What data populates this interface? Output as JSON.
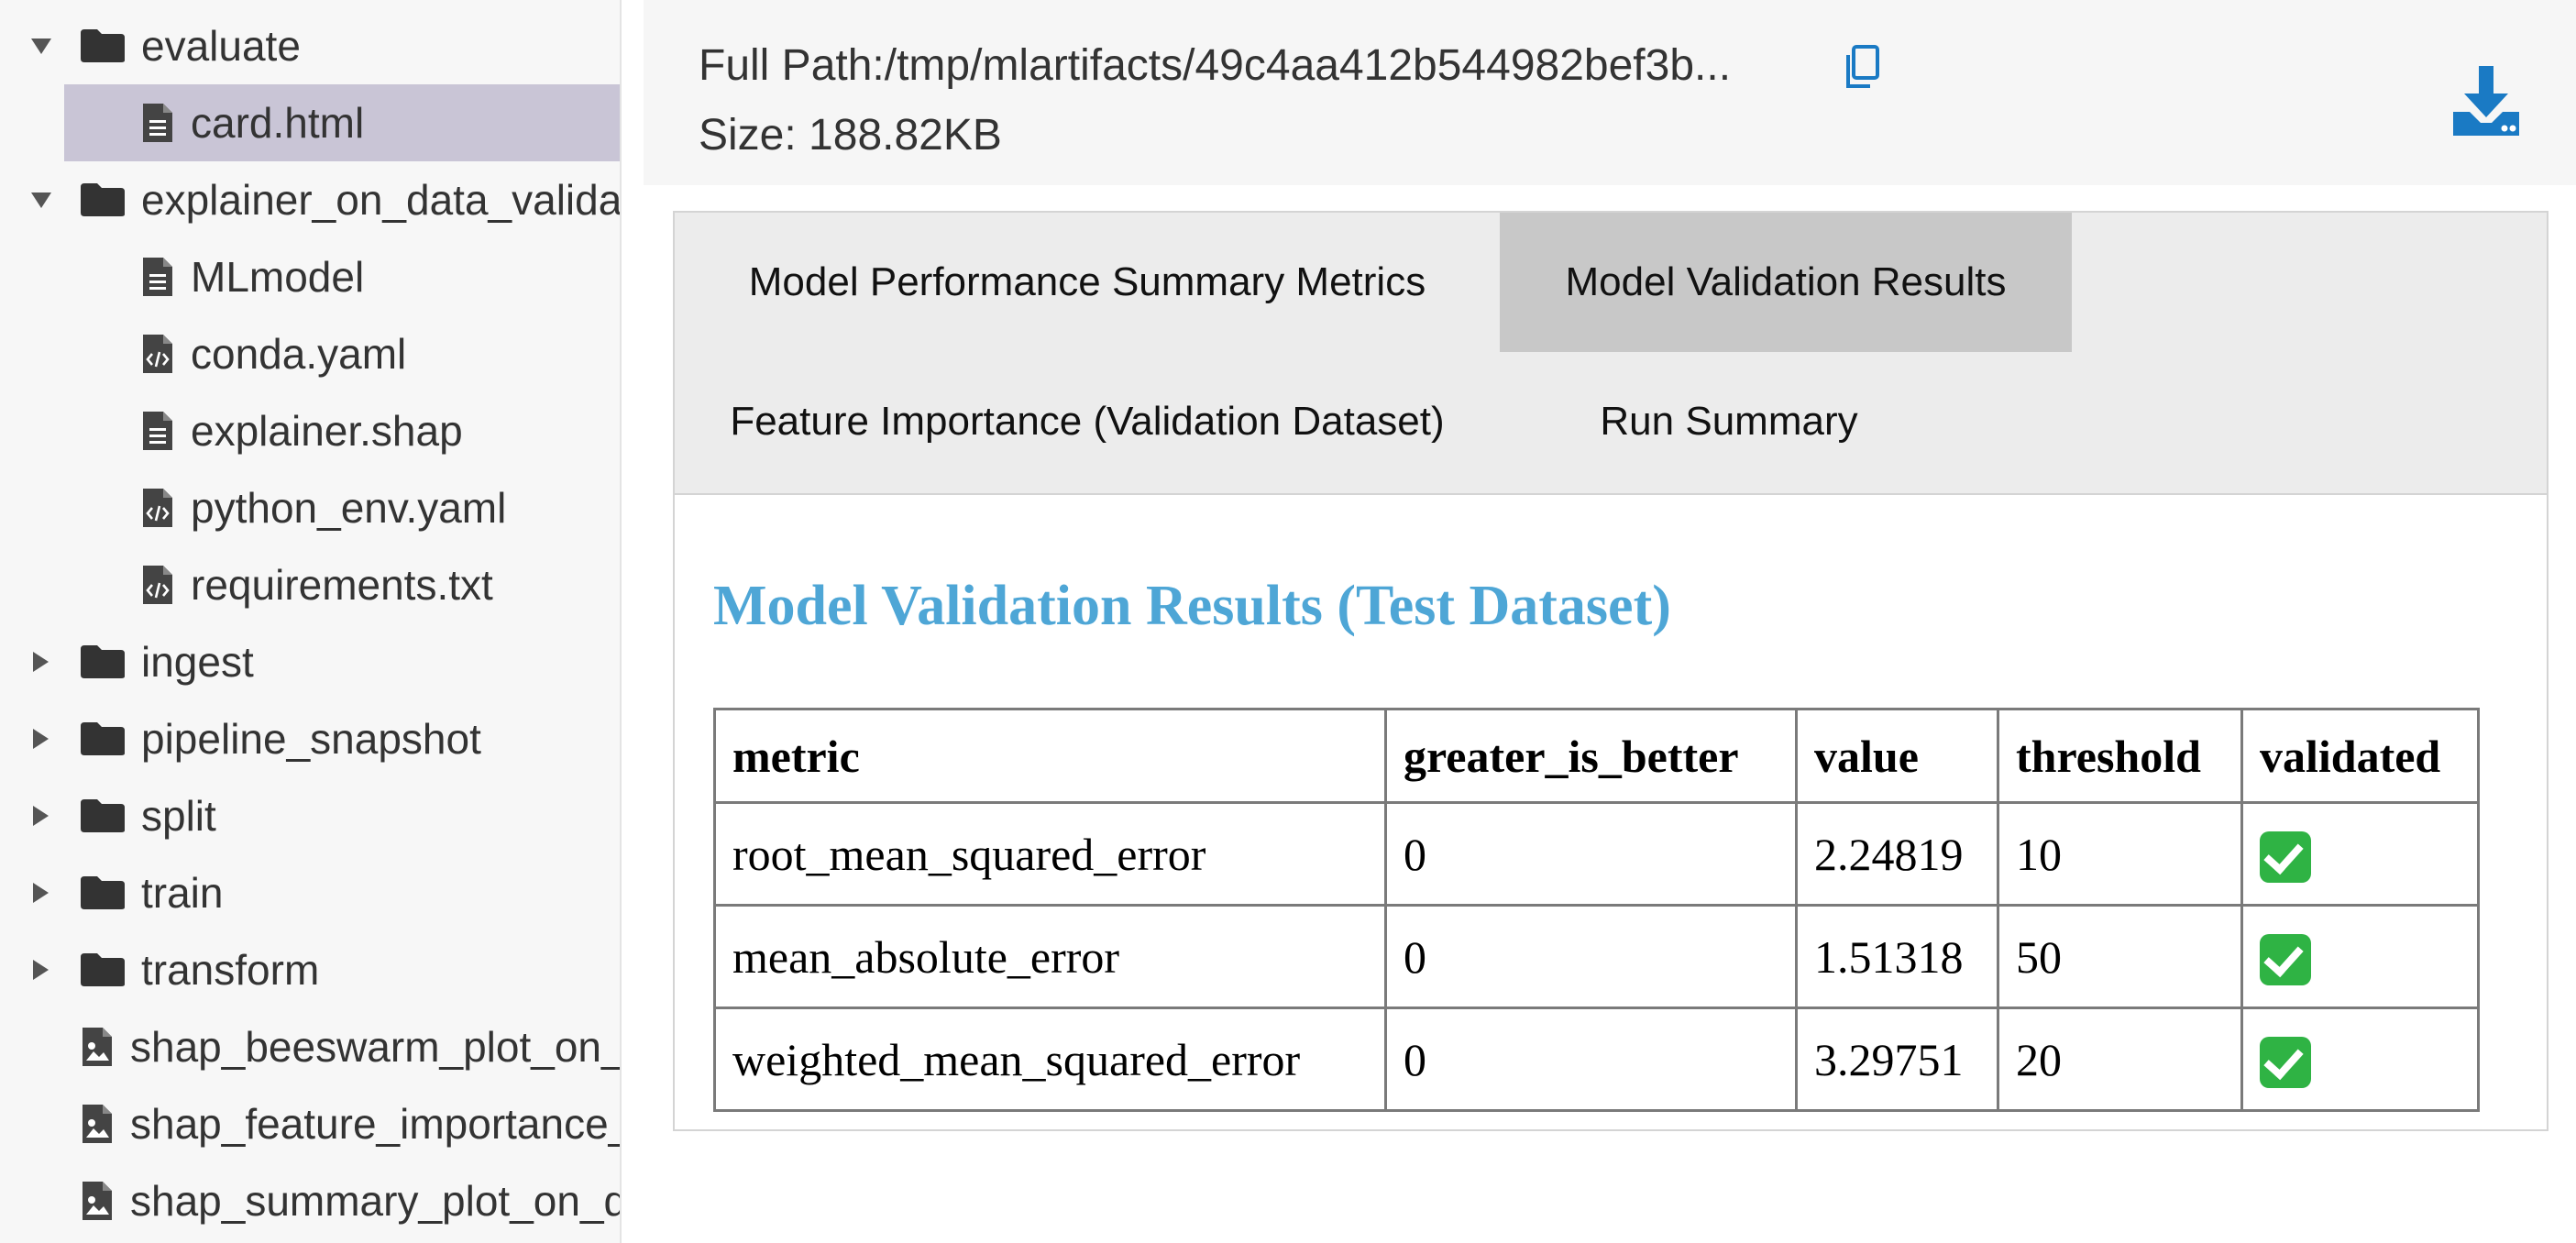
{
  "sidebar": {
    "items": [
      {
        "label": "evaluate",
        "type": "folder",
        "expanded": true,
        "level": 0,
        "icon": "folder-icon"
      },
      {
        "label": "card.html",
        "type": "file",
        "level": 1,
        "selected": true,
        "icon": "file-text-icon"
      },
      {
        "label": "explainer_on_data_validation",
        "type": "folder",
        "expanded": true,
        "level": 0,
        "icon": "folder-icon"
      },
      {
        "label": "MLmodel",
        "type": "file",
        "level": 1,
        "icon": "file-text-icon"
      },
      {
        "label": "conda.yaml",
        "type": "file",
        "level": 1,
        "icon": "file-code-icon"
      },
      {
        "label": "explainer.shap",
        "type": "file",
        "level": 1,
        "icon": "file-text-icon"
      },
      {
        "label": "python_env.yaml",
        "type": "file",
        "level": 1,
        "icon": "file-code-icon"
      },
      {
        "label": "requirements.txt",
        "type": "file",
        "level": 1,
        "icon": "file-code-icon"
      },
      {
        "label": "ingest",
        "type": "folder",
        "expanded": false,
        "level": 0,
        "icon": "folder-icon"
      },
      {
        "label": "pipeline_snapshot",
        "type": "folder",
        "expanded": false,
        "level": 0,
        "icon": "folder-icon"
      },
      {
        "label": "split",
        "type": "folder",
        "expanded": false,
        "level": 0,
        "icon": "folder-icon"
      },
      {
        "label": "train",
        "type": "folder",
        "expanded": false,
        "level": 0,
        "icon": "folder-icon"
      },
      {
        "label": "transform",
        "type": "folder",
        "expanded": false,
        "level": 0,
        "icon": "folder-icon"
      },
      {
        "label": "shap_beeswarm_plot_on_data_validation",
        "type": "file",
        "level": 0,
        "icon": "file-image-icon"
      },
      {
        "label": "shap_feature_importance_plot_on_data_validation",
        "type": "file",
        "level": 0,
        "icon": "file-image-icon"
      },
      {
        "label": "shap_summary_plot_on_data_validation",
        "type": "file",
        "level": 0,
        "icon": "file-image-icon"
      }
    ]
  },
  "artifact": {
    "full_path": "Full Path:/tmp/mlartifacts/49c4aa412b544982bef3b...",
    "size": "Size: 188.82KB"
  },
  "tabs": [
    {
      "label": "Model Performance Summary Metrics",
      "active": false
    },
    {
      "label": "Model Validation Results",
      "active": true
    },
    {
      "label": "Feature Importance (Validation Dataset)",
      "active": false
    },
    {
      "label": "Run Summary",
      "active": false
    }
  ],
  "section": {
    "title": "Model Validation Results (Test Dataset)"
  },
  "table": {
    "columns": [
      "metric",
      "greater_is_better",
      "value",
      "threshold",
      "validated"
    ],
    "rows": [
      [
        "root_mean_squared_error",
        "0",
        "2.24819",
        "10",
        "check-icon"
      ],
      [
        "mean_absolute_error",
        "0",
        "1.51318",
        "50",
        "check-icon"
      ],
      [
        "weighted_mean_squared_error",
        "0",
        "3.29751",
        "20",
        "check-icon"
      ]
    ]
  },
  "colors": {
    "accent_blue": "#4ea6d6",
    "icon_blue": "#1a7ac4",
    "selected_row": "#c9c5d6",
    "check_green": "#2fb344"
  }
}
